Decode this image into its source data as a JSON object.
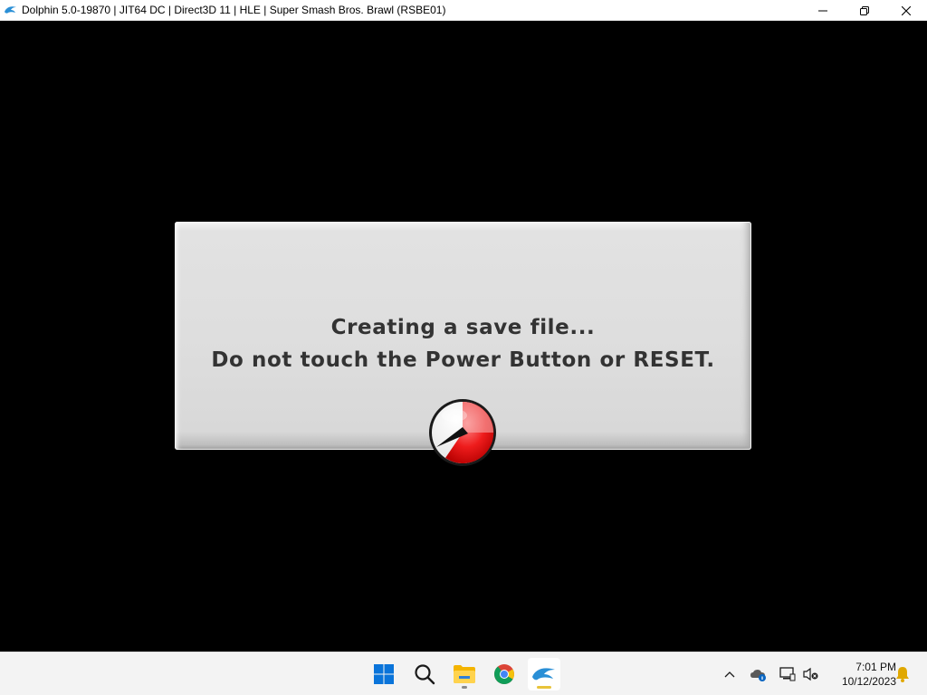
{
  "window": {
    "title": "Dolphin 5.0-19870 | JIT64 DC | Direct3D 11 | HLE | Super Smash Bros. Brawl (RSBE01)",
    "icons": {
      "app": "dolphin-icon",
      "minimize": "minimize-icon",
      "restore": "restore-icon",
      "close": "close-icon"
    }
  },
  "game": {
    "dialog": {
      "line1": "Creating a save file...",
      "line2": "Do not touch the Power Button or RESET."
    },
    "spinner": {
      "icon": "save-progress-icon",
      "accent": "#e02020"
    }
  },
  "taskbar": {
    "apps": [
      {
        "name": "start",
        "icon": "windows-start-icon"
      },
      {
        "name": "search",
        "icon": "search-icon"
      },
      {
        "name": "file-explorer",
        "icon": "folder-icon"
      },
      {
        "name": "chrome",
        "icon": "chrome-icon"
      },
      {
        "name": "dolphin",
        "icon": "dolphin-icon"
      }
    ],
    "tray": {
      "icons": [
        "chevron-up-icon",
        "onedrive-icon",
        "network-icon",
        "volume-muted-icon",
        "notification-bell-icon"
      ],
      "time": "7:01 PM",
      "date": "10/12/2023"
    },
    "colors": {
      "accent": "#0078d4",
      "indicator": "#e8c33a"
    }
  }
}
